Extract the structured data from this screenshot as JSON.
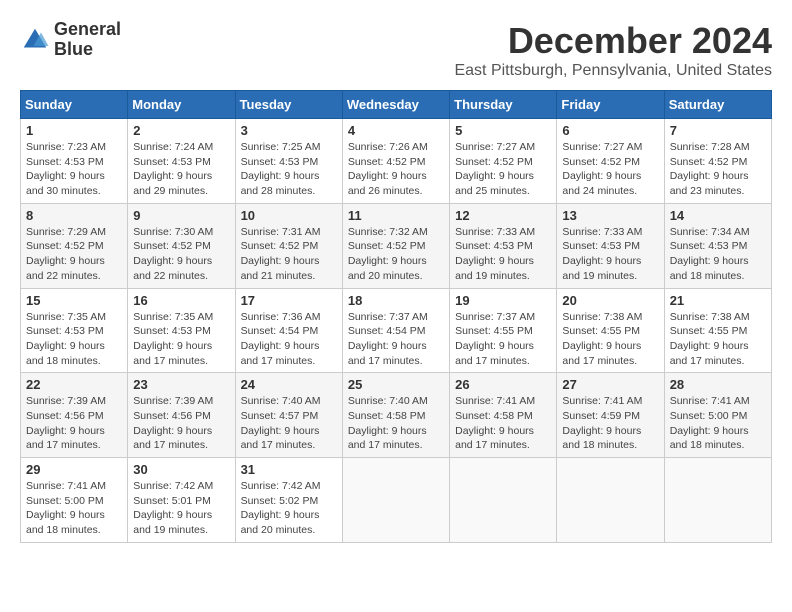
{
  "logo": {
    "line1": "General",
    "line2": "Blue"
  },
  "title": "December 2024",
  "subtitle": "East Pittsburgh, Pennsylvania, United States",
  "days_header": [
    "Sunday",
    "Monday",
    "Tuesday",
    "Wednesday",
    "Thursday",
    "Friday",
    "Saturday"
  ],
  "weeks": [
    [
      {
        "day": "1",
        "sunrise": "Sunrise: 7:23 AM",
        "sunset": "Sunset: 4:53 PM",
        "daylight": "Daylight: 9 hours and 30 minutes."
      },
      {
        "day": "2",
        "sunrise": "Sunrise: 7:24 AM",
        "sunset": "Sunset: 4:53 PM",
        "daylight": "Daylight: 9 hours and 29 minutes."
      },
      {
        "day": "3",
        "sunrise": "Sunrise: 7:25 AM",
        "sunset": "Sunset: 4:53 PM",
        "daylight": "Daylight: 9 hours and 28 minutes."
      },
      {
        "day": "4",
        "sunrise": "Sunrise: 7:26 AM",
        "sunset": "Sunset: 4:52 PM",
        "daylight": "Daylight: 9 hours and 26 minutes."
      },
      {
        "day": "5",
        "sunrise": "Sunrise: 7:27 AM",
        "sunset": "Sunset: 4:52 PM",
        "daylight": "Daylight: 9 hours and 25 minutes."
      },
      {
        "day": "6",
        "sunrise": "Sunrise: 7:27 AM",
        "sunset": "Sunset: 4:52 PM",
        "daylight": "Daylight: 9 hours and 24 minutes."
      },
      {
        "day": "7",
        "sunrise": "Sunrise: 7:28 AM",
        "sunset": "Sunset: 4:52 PM",
        "daylight": "Daylight: 9 hours and 23 minutes."
      }
    ],
    [
      {
        "day": "8",
        "sunrise": "Sunrise: 7:29 AM",
        "sunset": "Sunset: 4:52 PM",
        "daylight": "Daylight: 9 hours and 22 minutes."
      },
      {
        "day": "9",
        "sunrise": "Sunrise: 7:30 AM",
        "sunset": "Sunset: 4:52 PM",
        "daylight": "Daylight: 9 hours and 22 minutes."
      },
      {
        "day": "10",
        "sunrise": "Sunrise: 7:31 AM",
        "sunset": "Sunset: 4:52 PM",
        "daylight": "Daylight: 9 hours and 21 minutes."
      },
      {
        "day": "11",
        "sunrise": "Sunrise: 7:32 AM",
        "sunset": "Sunset: 4:52 PM",
        "daylight": "Daylight: 9 hours and 20 minutes."
      },
      {
        "day": "12",
        "sunrise": "Sunrise: 7:33 AM",
        "sunset": "Sunset: 4:53 PM",
        "daylight": "Daylight: 9 hours and 19 minutes."
      },
      {
        "day": "13",
        "sunrise": "Sunrise: 7:33 AM",
        "sunset": "Sunset: 4:53 PM",
        "daylight": "Daylight: 9 hours and 19 minutes."
      },
      {
        "day": "14",
        "sunrise": "Sunrise: 7:34 AM",
        "sunset": "Sunset: 4:53 PM",
        "daylight": "Daylight: 9 hours and 18 minutes."
      }
    ],
    [
      {
        "day": "15",
        "sunrise": "Sunrise: 7:35 AM",
        "sunset": "Sunset: 4:53 PM",
        "daylight": "Daylight: 9 hours and 18 minutes."
      },
      {
        "day": "16",
        "sunrise": "Sunrise: 7:35 AM",
        "sunset": "Sunset: 4:53 PM",
        "daylight": "Daylight: 9 hours and 17 minutes."
      },
      {
        "day": "17",
        "sunrise": "Sunrise: 7:36 AM",
        "sunset": "Sunset: 4:54 PM",
        "daylight": "Daylight: 9 hours and 17 minutes."
      },
      {
        "day": "18",
        "sunrise": "Sunrise: 7:37 AM",
        "sunset": "Sunset: 4:54 PM",
        "daylight": "Daylight: 9 hours and 17 minutes."
      },
      {
        "day": "19",
        "sunrise": "Sunrise: 7:37 AM",
        "sunset": "Sunset: 4:55 PM",
        "daylight": "Daylight: 9 hours and 17 minutes."
      },
      {
        "day": "20",
        "sunrise": "Sunrise: 7:38 AM",
        "sunset": "Sunset: 4:55 PM",
        "daylight": "Daylight: 9 hours and 17 minutes."
      },
      {
        "day": "21",
        "sunrise": "Sunrise: 7:38 AM",
        "sunset": "Sunset: 4:55 PM",
        "daylight": "Daylight: 9 hours and 17 minutes."
      }
    ],
    [
      {
        "day": "22",
        "sunrise": "Sunrise: 7:39 AM",
        "sunset": "Sunset: 4:56 PM",
        "daylight": "Daylight: 9 hours and 17 minutes."
      },
      {
        "day": "23",
        "sunrise": "Sunrise: 7:39 AM",
        "sunset": "Sunset: 4:56 PM",
        "daylight": "Daylight: 9 hours and 17 minutes."
      },
      {
        "day": "24",
        "sunrise": "Sunrise: 7:40 AM",
        "sunset": "Sunset: 4:57 PM",
        "daylight": "Daylight: 9 hours and 17 minutes."
      },
      {
        "day": "25",
        "sunrise": "Sunrise: 7:40 AM",
        "sunset": "Sunset: 4:58 PM",
        "daylight": "Daylight: 9 hours and 17 minutes."
      },
      {
        "day": "26",
        "sunrise": "Sunrise: 7:41 AM",
        "sunset": "Sunset: 4:58 PM",
        "daylight": "Daylight: 9 hours and 17 minutes."
      },
      {
        "day": "27",
        "sunrise": "Sunrise: 7:41 AM",
        "sunset": "Sunset: 4:59 PM",
        "daylight": "Daylight: 9 hours and 18 minutes."
      },
      {
        "day": "28",
        "sunrise": "Sunrise: 7:41 AM",
        "sunset": "Sunset: 5:00 PM",
        "daylight": "Daylight: 9 hours and 18 minutes."
      }
    ],
    [
      {
        "day": "29",
        "sunrise": "Sunrise: 7:41 AM",
        "sunset": "Sunset: 5:00 PM",
        "daylight": "Daylight: 9 hours and 18 minutes."
      },
      {
        "day": "30",
        "sunrise": "Sunrise: 7:42 AM",
        "sunset": "Sunset: 5:01 PM",
        "daylight": "Daylight: 9 hours and 19 minutes."
      },
      {
        "day": "31",
        "sunrise": "Sunrise: 7:42 AM",
        "sunset": "Sunset: 5:02 PM",
        "daylight": "Daylight: 9 hours and 20 minutes."
      },
      null,
      null,
      null,
      null
    ]
  ]
}
